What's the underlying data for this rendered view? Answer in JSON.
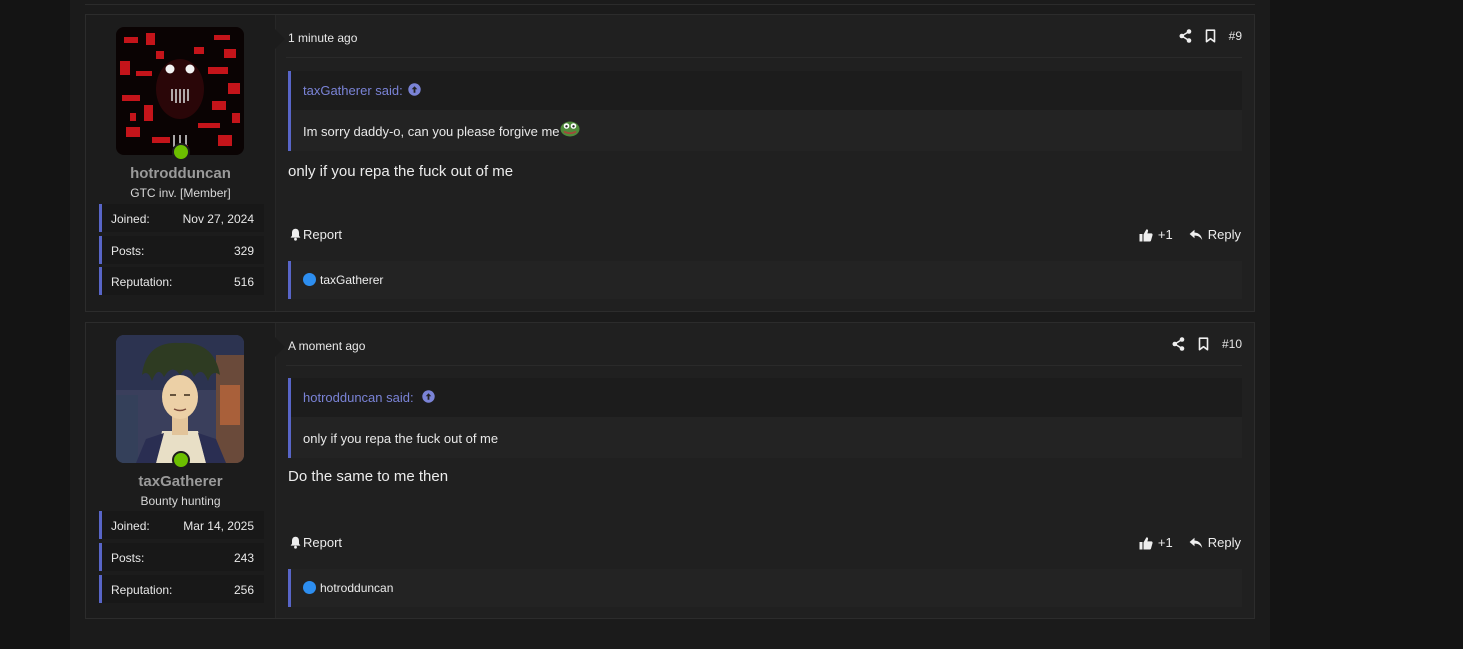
{
  "posts": [
    {
      "author": {
        "name": "hotrodduncan",
        "title": "GTC inv. [Member]",
        "stats": [
          {
            "label": "Joined:",
            "value": "Nov 27, 2024"
          },
          {
            "label": "Posts:",
            "value": "329"
          },
          {
            "label": "Reputation:",
            "value": "516"
          }
        ]
      },
      "time": "1 minute ago",
      "number": "#9",
      "quote": {
        "attribution": "taxGatherer said:",
        "text": "Im sorry daddy-o, can you please forgive me"
      },
      "message": "only if you repa the fuck out of me",
      "report_label": "Report",
      "like_count": "+1",
      "reply_label": "Reply",
      "reacted_by": "taxGatherer"
    },
    {
      "author": {
        "name": "taxGatherer",
        "title": "Bounty hunting",
        "stats": [
          {
            "label": "Joined:",
            "value": "Mar 14, 2025"
          },
          {
            "label": "Posts:",
            "value": "243"
          },
          {
            "label": "Reputation:",
            "value": "256"
          }
        ]
      },
      "time": "A moment ago",
      "number": "#10",
      "quote": {
        "attribution": "hotrodduncan said:",
        "text": "only if you repa the fuck out of me"
      },
      "message": "Do the same to me then",
      "report_label": "Report",
      "like_count": "+1",
      "reply_label": "Reply",
      "reacted_by": "hotrodduncan"
    }
  ],
  "colors": {
    "accent": "#5865c7",
    "online": "#6cbf00",
    "link": "#7a83d6"
  },
  "icons": [
    "share-icon",
    "bookmark-icon",
    "bell-icon",
    "thumbs-up-icon",
    "reply-icon",
    "arrow-up-circle-icon"
  ]
}
